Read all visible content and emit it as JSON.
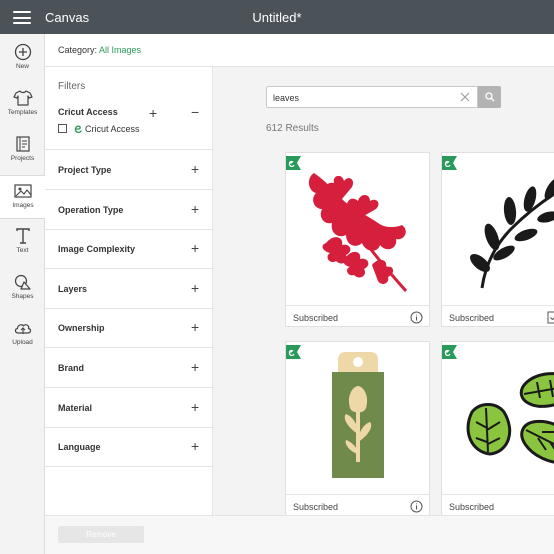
{
  "topbar": {
    "app_title": "Canvas",
    "doc_title": "Untitled*"
  },
  "rail": [
    {
      "label": "New",
      "icon": "plus-circle-icon"
    },
    {
      "label": "Templates",
      "icon": "shirt-icon"
    },
    {
      "label": "Projects",
      "icon": "projects-icon"
    },
    {
      "label": "Images",
      "icon": "image-icon",
      "active": true
    },
    {
      "label": "Text",
      "icon": "text-icon"
    },
    {
      "label": "Shapes",
      "icon": "shapes-icon"
    },
    {
      "label": "Upload",
      "icon": "upload-cloud-icon"
    }
  ],
  "category": {
    "prefix": "Category: ",
    "value": "All Images"
  },
  "filters": {
    "title": "Filters",
    "cricut_access": {
      "title": "Cricut Access",
      "checkbox_label": "Cricut Access",
      "checked": false
    },
    "rows": [
      "Project Type",
      "Operation Type",
      "Image Complexity",
      "Layers",
      "Ownership",
      "Brand",
      "Material",
      "Language"
    ]
  },
  "search": {
    "value": "leaves",
    "placeholder": ""
  },
  "results": {
    "count_text": "612 Results",
    "cards": [
      {
        "status": "Subscribed",
        "image": "red-leaf-sprig"
      },
      {
        "status": "Subscribed",
        "image": "black-leaf-branch"
      },
      {
        "status": "Subscribed",
        "image": "floral-gift-tag"
      },
      {
        "status": "Subscribed",
        "image": "green-leaves-set"
      }
    ]
  },
  "footer": {
    "remove_label": "Remove"
  },
  "colors": {
    "accent_green": "#2a9a5b",
    "topbar": "#4b5258",
    "leaf_red": "#d61f3c",
    "leaf_green": "#8bc53f",
    "tag_green": "#6f8a4a",
    "tag_tan": "#eed8a8"
  }
}
